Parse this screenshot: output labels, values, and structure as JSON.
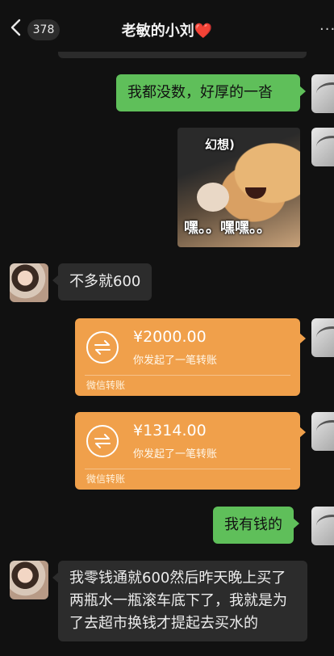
{
  "header": {
    "back_count": "378",
    "title": "老敏的小刘",
    "title_heart": "❤️",
    "more": "···"
  },
  "messages": {
    "m1_text": "我都没数，好厚的一沓",
    "sticker": {
      "caption_top": "幻想)",
      "caption_bottom": "嘿。。嘿嘿。。"
    },
    "m2_text": "不多就600",
    "transfer1": {
      "amount": "¥2000.00",
      "desc": "你发起了一笔转账",
      "footer": "微信转账"
    },
    "transfer2": {
      "amount": "¥1314.00",
      "desc": "你发起了一笔转账",
      "footer": "微信转账"
    },
    "m3_text": "我有钱的",
    "m4_text": "我零钱通就600然后昨天晚上买了两瓶水一瓶滚车底下了，我就是为了去超市换钱才提起去买水的"
  },
  "colors": {
    "background": "#111111",
    "bubble_sent": "#5fbf5a",
    "bubble_received": "#2c2c2c",
    "transfer_card": "#f0a04b"
  },
  "icons": [
    "chevron-left-icon",
    "more-icon",
    "transfer-icon"
  ]
}
